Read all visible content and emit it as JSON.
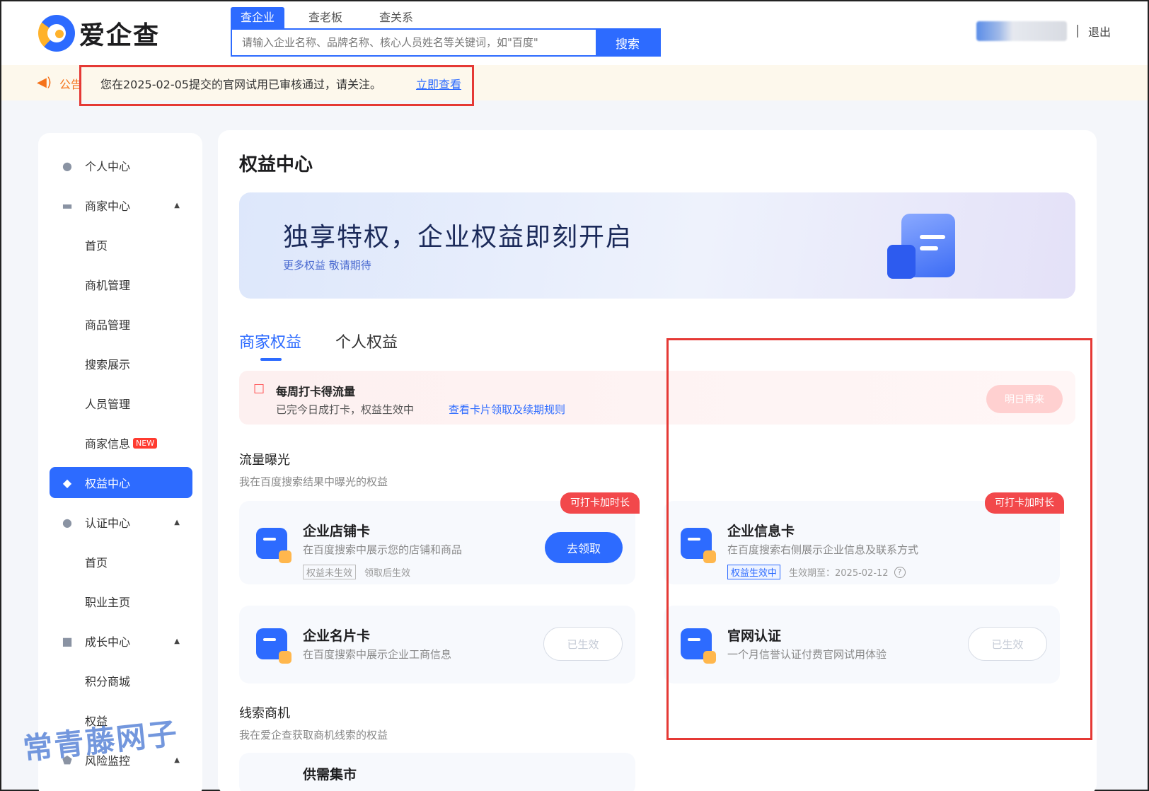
{
  "header": {
    "logo_text": "爱企查",
    "search_tabs": [
      "查企业",
      "查老板",
      "查关系"
    ],
    "search_placeholder": "请输入企业名称、品牌名称、核心人员姓名等关键词，如\"百度\"",
    "search_button": "搜索",
    "logout": "退出"
  },
  "notice": {
    "label": "公告",
    "text": "您在2025-02-05提交的官网试用已审核通过，请关注。",
    "link": "立即查看"
  },
  "sidebar": {
    "items": [
      {
        "label": "个人中心",
        "icon": "user-icon"
      },
      {
        "label": "商家中心",
        "icon": "store-icon"
      },
      {
        "label": "首页"
      },
      {
        "label": "商机管理"
      },
      {
        "label": "商品管理"
      },
      {
        "label": "搜索展示"
      },
      {
        "label": "人员管理"
      },
      {
        "label": "商家信息",
        "badge": "NEW"
      },
      {
        "label": "权益中心",
        "icon": "diamond-icon",
        "active": true
      },
      {
        "label": "认证中心",
        "icon": "verify-icon"
      },
      {
        "label": "首页"
      },
      {
        "label": "职业主页"
      },
      {
        "label": "成长中心",
        "icon": "growth-icon"
      },
      {
        "label": "积分商城"
      },
      {
        "label": "权益"
      },
      {
        "label": "风险监控",
        "icon": "shield-icon"
      }
    ]
  },
  "main": {
    "title": "权益中心",
    "banner_title": "独享特权，企业权益即刻开启",
    "banner_sub": "更多权益 敬请期待",
    "tabs": [
      "商家权益",
      "个人权益"
    ],
    "checkin": {
      "title": "每周打卡得流量",
      "desc": "已完今日成打卡，权益生效中",
      "link": "查看卡片领取及续期规则",
      "button": "明日再来"
    },
    "section1": {
      "title": "流量曝光",
      "sub": "我在百度搜索结果中曝光的权益"
    },
    "cards": [
      {
        "name": "企业店铺卡",
        "desc": "在百度搜索中展示您的店铺和商品",
        "tag": "权益未生效",
        "meta": "领取后生效",
        "ribbon": "可打卡加时长",
        "button": "去领取"
      },
      {
        "name": "企业信息卡",
        "desc": "在百度搜索右侧展示企业信息及联系方式",
        "tag": "权益生效中",
        "meta": "生效期至：2025-02-12",
        "ribbon": "可打卡加时长"
      },
      {
        "name": "企业名片卡",
        "desc": "在百度搜索中展示企业工商信息",
        "button": "已生效"
      },
      {
        "name": "官网认证",
        "desc": "一个月信誉认证付费官网试用体验",
        "button": "已生效"
      }
    ],
    "section2": {
      "title": "线索商机",
      "sub": "我在爱企查获取商机线索的权益"
    },
    "partial_card": "供需集市"
  },
  "watermark": "常青藤网子"
}
